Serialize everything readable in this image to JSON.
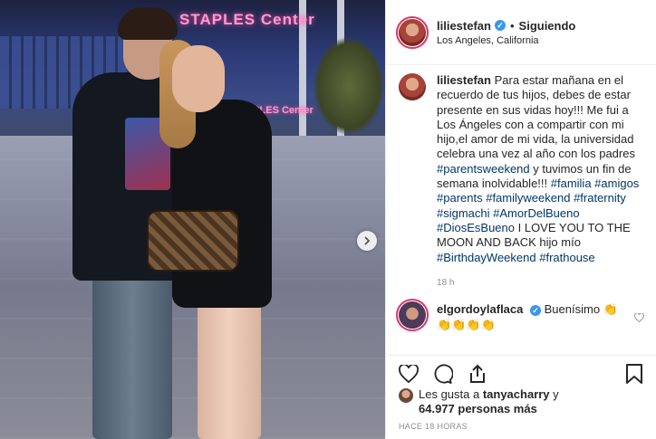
{
  "photo": {
    "arena_sign": "STAPLES Center",
    "arena_sign_lower": "STAPLES Center",
    "next_icon": "chevron-right-icon"
  },
  "header": {
    "username": "liliestefan",
    "verified": "✓",
    "separator": "•",
    "follow_status": "Siguiendo",
    "location": "Los Angeles, California"
  },
  "caption": {
    "username": "liliestefan",
    "text": "Para estar mañana en el recuerdo de tus hijos, debes de estar presente en sus vidas hoy!!! Me fui a Los Ángeles con a compartir con mi hijo,el amor de mi vida, la universidad celebra una vez al año con los padres",
    "tag1": "#parentsweekend",
    "mid": " y tuvimos un fin de semana inolvidable!!! ",
    "tag2": "#familia",
    "tags_line": [
      "#amigos",
      "#parents",
      "#familyweekend",
      "#fraternity",
      "#sigmachi",
      "#AmorDelBueno",
      "#DiosEsBueno"
    ],
    "outro": " I LOVE YOU TO THE MOON AND BACK hijo mío ",
    "tag_birthday": "#BirthdayWeekend",
    "tag_last": "#frathouse",
    "time": "18 h"
  },
  "comment": {
    "username": "elgordoylaflaca",
    "verified": "✓",
    "text": "Buenísimo 👏",
    "text2": "👏👏👏👏"
  },
  "actions": {
    "like": "heart-icon",
    "comment": "comment-icon",
    "share": "share-icon",
    "save": "bookmark-icon"
  },
  "likes": {
    "prefix": "Les gusta a ",
    "user": "tanyacharry",
    "mid": " y",
    "count": "64.977 personas más"
  },
  "timestamp": "HACE 18 HORAS"
}
